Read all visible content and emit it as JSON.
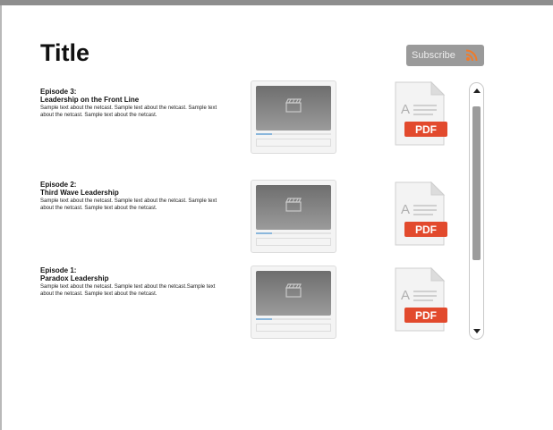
{
  "page": {
    "title": "Title"
  },
  "subscribe": {
    "label": "Subscribe",
    "icon": "rss-icon"
  },
  "episodes": [
    {
      "number": "Episode 3:",
      "title": "Leadership on the Front Line",
      "description": "Sample text about the netcast. Sample text about the netcast. Sample text about the netcast. Sample text about the netcast."
    },
    {
      "number": "Episode 2:",
      "title": "Third Wave Leadership",
      "description": "Sample text about the netcast. Sample text about the netcast. Sample text about the netcast. Sample text about the netcast."
    },
    {
      "number": "Episode 1:",
      "title": "Paradox Leadership",
      "description": "Sample text about the netcast. Sample text about the netcast.Sample text about the netcast. Sample text about the netcast."
    }
  ],
  "pdf": {
    "label": "PDF",
    "accent": "#e24a2d"
  },
  "colors": {
    "subscribe_bg": "#9a9a9a",
    "rss_orange": "#f07b2a"
  }
}
